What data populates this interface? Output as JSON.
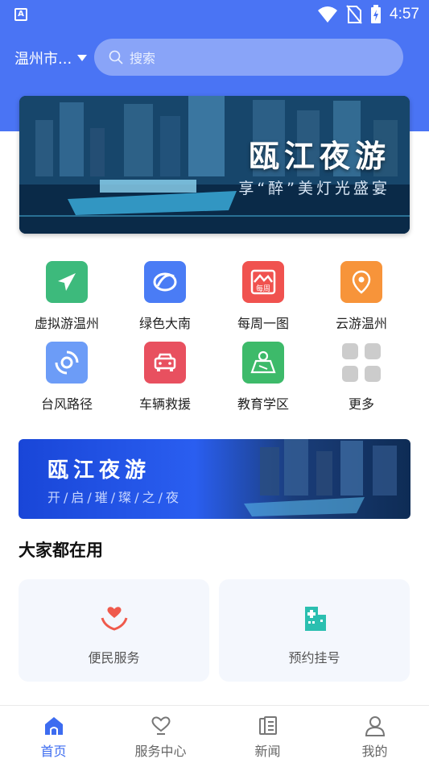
{
  "status_bar": {
    "time": "4:57"
  },
  "header": {
    "city": "温州市...",
    "search_placeholder": "搜索"
  },
  "banner": {
    "title": "瓯江夜游",
    "subtitle": "享“醉”美灯光盛宴"
  },
  "grid": [
    {
      "label": "虚拟游温州",
      "icon": "plane-icon",
      "color": "#3dba7c"
    },
    {
      "label": "绿色大南",
      "icon": "leaf-logo-icon",
      "color": "#4a7cf5"
    },
    {
      "label": "每周一图",
      "icon": "photo-weekly-icon",
      "icon_text": "每周",
      "color": "#f0524f"
    },
    {
      "label": "云游温州",
      "icon": "location-pin-icon",
      "color": "#f7943a"
    },
    {
      "label": "台风路径",
      "icon": "typhoon-icon",
      "color": "#6c9cf7"
    },
    {
      "label": "车辆救援",
      "icon": "car-icon",
      "color": "#e8505f"
    },
    {
      "label": "教育学区",
      "icon": "education-map-icon",
      "color": "#3dba6a"
    },
    {
      "label": "更多",
      "icon": "more-grid-icon",
      "color": "#cccccc"
    }
  ],
  "banner2": {
    "title": "瓯江夜游",
    "subtitle": "开/启/璀/璨/之/夜"
  },
  "section": {
    "title": "大家都在用",
    "cards": [
      {
        "label": "便民服务",
        "icon": "heart-hands-icon"
      },
      {
        "label": "预约挂号",
        "icon": "hospital-icon"
      }
    ]
  },
  "bottom_nav": [
    {
      "label": "首页",
      "icon": "home-icon",
      "active": true
    },
    {
      "label": "服务中心",
      "icon": "service-heart-icon"
    },
    {
      "label": "新闻",
      "icon": "news-icon"
    },
    {
      "label": "我的",
      "icon": "profile-icon"
    }
  ],
  "colors": {
    "primary": "#4a74f4",
    "active_nav": "#3d6cf0"
  }
}
